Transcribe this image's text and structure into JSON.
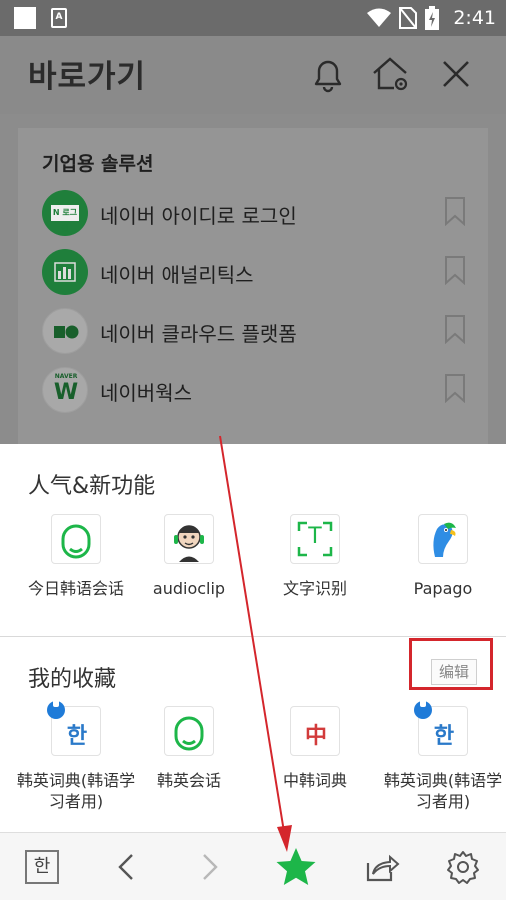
{
  "status_bar": {
    "time": "2:41",
    "icons": [
      "square-icon",
      "android-a-icon",
      "wifi-icon",
      "no-sim-icon",
      "battery-icon"
    ]
  },
  "background_page": {
    "title": "바로가기",
    "header_icons": [
      "bell-icon",
      "home-settings-icon",
      "close-icon"
    ],
    "section_title": "기업용 솔루션",
    "items": [
      {
        "label": "네이버 아이디로 로그인",
        "icon": "naver-login-icon",
        "icon_text": "N 로그인"
      },
      {
        "label": "네이버 애널리틱스",
        "icon": "analytics-icon"
      },
      {
        "label": "네이버 클라우드 플랫폼",
        "icon": "cloud-platform-icon"
      },
      {
        "label": "네이버웍스",
        "icon": "naver-works-icon",
        "icon_text": "NAVER"
      }
    ]
  },
  "sheet": {
    "popular": {
      "title": "人气&新功能",
      "items": [
        {
          "label": "今日韩语会话",
          "icon": "headset-icon"
        },
        {
          "label": "audioclip",
          "icon": "audioclip-avatar-icon"
        },
        {
          "label": "文字识别",
          "icon": "text-recognition-icon",
          "icon_text": "T"
        },
        {
          "label": "Papago",
          "icon": "papago-parrot-icon"
        }
      ]
    },
    "favorites": {
      "title": "我的收藏",
      "edit_label": "编辑",
      "items": [
        {
          "label": "韩英词典(韩语学习者用)",
          "icon": "korean-dictionary-icon",
          "icon_text": "한"
        },
        {
          "label": "韩英会话",
          "icon": "headset-icon"
        },
        {
          "label": "中韩词典",
          "icon": "chinese-dictionary-icon",
          "icon_text": "中"
        },
        {
          "label": "韩英词典(韩语学习者用)",
          "icon": "korean-dictionary-icon",
          "icon_text": "한"
        }
      ]
    }
  },
  "toolbar": {
    "han_label": "한",
    "buttons": [
      "korean-keyboard-icon",
      "back-icon",
      "forward-icon",
      "star-icon",
      "share-icon",
      "settings-icon"
    ]
  },
  "colors": {
    "accent_green": "#1db649",
    "annotation_red": "#d4262c",
    "dictionary_blue": "#2a79c9"
  }
}
